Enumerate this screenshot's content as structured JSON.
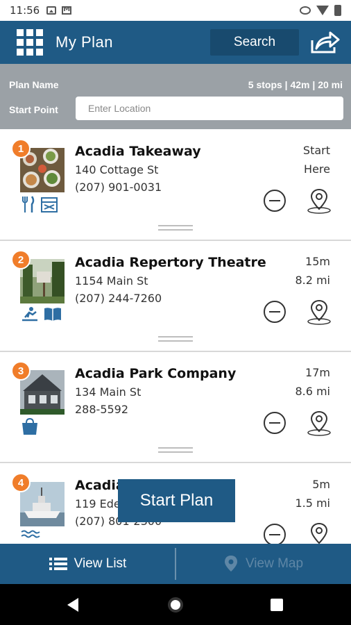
{
  "status_bar": {
    "time": "11:56"
  },
  "header": {
    "title": "My Plan",
    "search_label": "Search"
  },
  "plan": {
    "plan_name_label": "Plan Name",
    "stats": "5 stops | 42m | 20 mi",
    "start_point_label": "Start Point",
    "start_point_placeholder": "Enter Location"
  },
  "stops": [
    {
      "number": "1",
      "name": "Acadia Takeaway",
      "address": "140 Cottage St",
      "phone": "(207) 901-0031",
      "time": "Start",
      "distance": "Here"
    },
    {
      "number": "2",
      "name": "Acadia Repertory Theatre",
      "address": "1154 Main St",
      "phone": "(207) 244-7260",
      "time": "15m",
      "distance": "8.2 mi"
    },
    {
      "number": "3",
      "name": "Acadia Park Company",
      "address": "134 Main St",
      "phone": "288-5592",
      "time": "17m",
      "distance": "8.6 mi"
    },
    {
      "number": "4",
      "name": "Acadia",
      "address": "119 Ede",
      "phone": "(207) 801-2300",
      "time": "5m",
      "distance": "1.5 mi"
    }
  ],
  "start_plan_label": "Start Plan",
  "tabs": {
    "list_label": "View List",
    "map_label": "View Map"
  },
  "colors": {
    "primary": "#1f5a85",
    "badge": "#f07d2a",
    "plan_bar": "#9ba1a6"
  }
}
